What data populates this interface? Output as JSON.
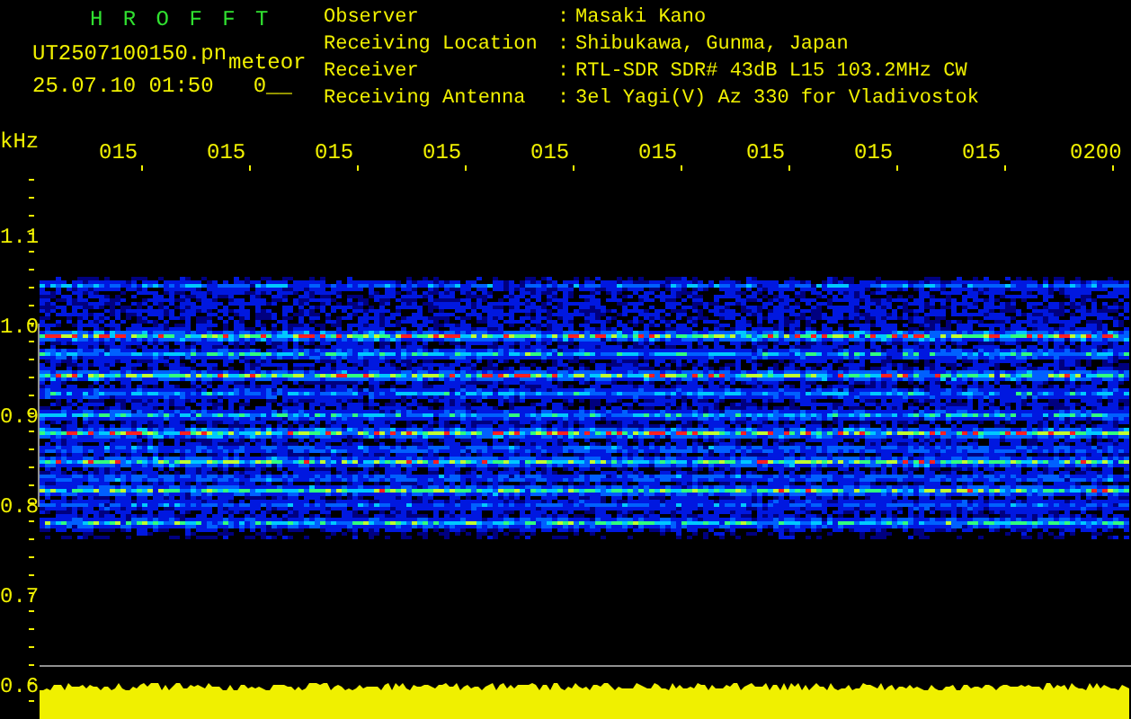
{
  "app": {
    "title": "H R O F F T",
    "file_name": "UT2507100150.pn",
    "file_suffix": "meteor",
    "timestamp": "25.07.10 01:50",
    "counter": "0__"
  },
  "station_info": [
    {
      "label": "Observer",
      "separator": ":",
      "value": "Masaki Kano"
    },
    {
      "label": "Receiving Location",
      "separator": ":",
      "value": "Shibukawa, Gunma, Japan"
    },
    {
      "label": "Receiver",
      "separator": ":",
      "value": "RTL-SDR SDR# 43dB L15 103.2MHz CW"
    },
    {
      "label": "Receiving Antenna",
      "separator": ":",
      "value": "3el Yagi(V) Az 330 for Vladivostok"
    }
  ],
  "x_axis": {
    "labels": [
      "015",
      "015",
      "015",
      "015",
      "015",
      "015",
      "015",
      "015",
      "015",
      "0200"
    ]
  },
  "y_axis": {
    "unit": "kHz",
    "labels": [
      "1.1",
      "1.0",
      "0.9",
      "0.8",
      "0.7",
      "0.6"
    ]
  }
}
